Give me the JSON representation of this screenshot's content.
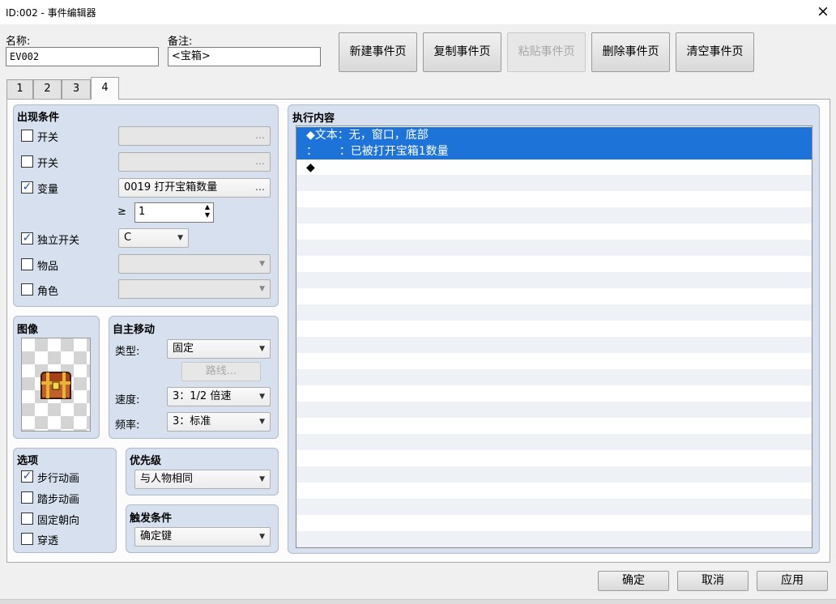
{
  "window": {
    "title": "ID:002 - 事件编辑器",
    "close_icon": "×"
  },
  "header": {
    "name_label": "名称:",
    "name_value": "EV002",
    "note_label": "备注:",
    "note_value": "<宝箱>",
    "buttons": [
      "新建事件页",
      "复制事件页",
      "粘贴事件页",
      "删除事件页",
      "清空事件页"
    ]
  },
  "tabs": [
    "1",
    "2",
    "3",
    "4"
  ],
  "active_tab": "4",
  "conditions": {
    "title": "出现条件",
    "switch1": {
      "label": "开关",
      "checked": false,
      "value": "",
      "ellipsis": "…"
    },
    "switch2": {
      "label": "开关",
      "checked": false,
      "value": "",
      "ellipsis": "…"
    },
    "variable": {
      "label": "变量",
      "checked": true,
      "value": "0019 打开宝箱数量",
      "ellipsis": "…",
      "operator": "≥",
      "amount": "1"
    },
    "self_switch": {
      "label": "独立开关",
      "checked": true,
      "value": "C"
    },
    "item": {
      "label": "物品",
      "checked": false,
      "value": ""
    },
    "actor": {
      "label": "角色",
      "checked": false,
      "value": ""
    },
    "check_mark": "✓"
  },
  "image": {
    "title": "图像",
    "sprite": "treasure-chest"
  },
  "autonomous": {
    "title": "自主移动",
    "type_label": "类型:",
    "type_value": "固定",
    "route_button": "路线...",
    "speed_label": "速度:",
    "speed_value": "3：1/2 倍速",
    "freq_label": "频率:",
    "freq_value": "3：标准"
  },
  "options": {
    "title": "选项",
    "items": [
      {
        "label": "步行动画",
        "checked": true
      },
      {
        "label": "踏步动画",
        "checked": false
      },
      {
        "label": "固定朝向",
        "checked": false
      },
      {
        "label": "穿透",
        "checked": false
      }
    ]
  },
  "priority": {
    "title": "优先级",
    "value": "与人物相同"
  },
  "trigger": {
    "title": "触发条件",
    "value": "确定键"
  },
  "contents": {
    "title": "执行内容",
    "lines": [
      "◆文本：无，窗口，底部",
      "：      ：已被打开宝箱1数量",
      "◆"
    ]
  },
  "footer": {
    "ok": "确定",
    "cancel": "取消",
    "apply": "应用"
  },
  "colors": {
    "panel": "#d6e0ee",
    "selection": "#1e73d8"
  }
}
